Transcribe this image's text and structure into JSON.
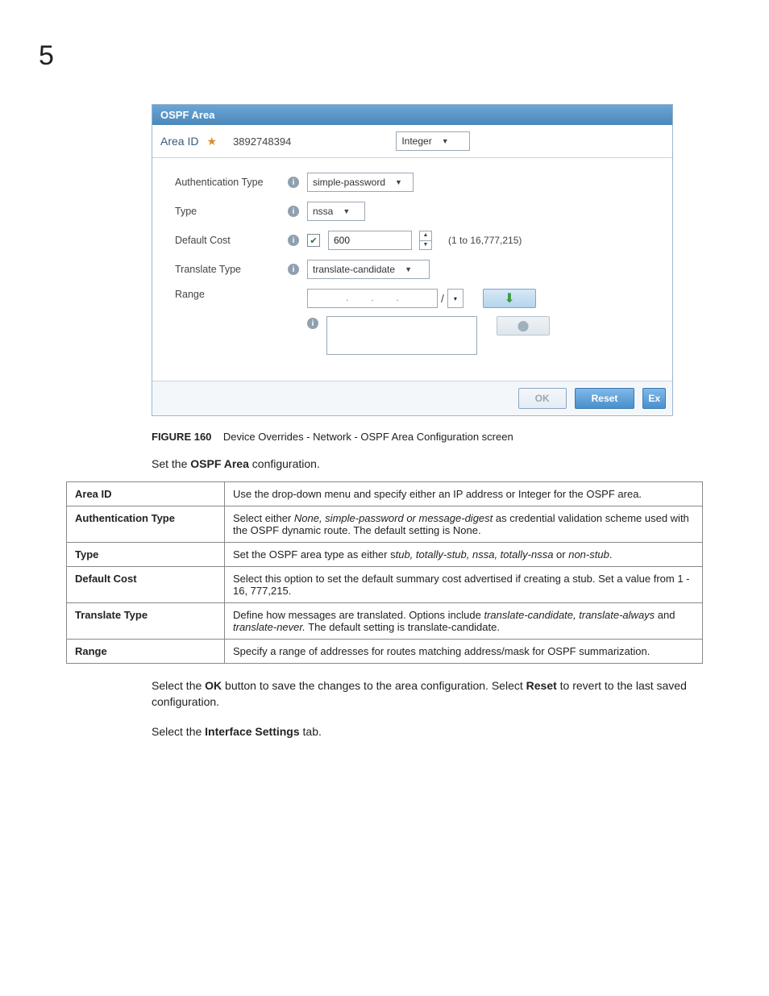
{
  "chapter": "5",
  "titlebar": "OSPF Area",
  "top": {
    "label": "Area ID",
    "value": "3892748394",
    "type_sel": "Integer"
  },
  "form": {
    "auth_label": "Authentication Type",
    "auth_value": "simple-password",
    "type_label": "Type",
    "type_value": "nssa",
    "defcost_label": "Default Cost",
    "defcost_value": "600",
    "defcost_hint": "(1 to 16,777,215)",
    "trans_label": "Translate Type",
    "trans_value": "translate-candidate",
    "range_label": "Range"
  },
  "buttons": {
    "ok": "OK",
    "reset": "Reset",
    "ex": "Ex"
  },
  "caption": {
    "fig": "FIGURE 160",
    "text": "Device Overrides - Network - OSPF Area Configuration screen"
  },
  "intro": {
    "pre": "Set the ",
    "bold": "OSPF Area",
    "post": " configuration."
  },
  "table": [
    {
      "k": "Area ID",
      "v": "Use the drop-down menu and specify either an IP address or Integer for the OSPF area."
    },
    {
      "k": "Authentication Type",
      "v": "Select either <i>None, simple-password or message-digest</i> as credential validation scheme used with the OSPF dynamic route. The default setting is None."
    },
    {
      "k": "Type",
      "v": "Set the OSPF area type as either s<i>tub, totally-stub, nssa, totally-nssa</i> or <i>non-stub</i>."
    },
    {
      "k": "Default Cost",
      "v": "Select this option to set the default summary cost advertised if creating a stub. Set a value from 1 - 16, 777,215."
    },
    {
      "k": "Translate Type",
      "v": "Define how messages are translated. Options include <i>translate-candidate, translate-always</i> and <i>translate-never.</i> The default setting is translate-candidate."
    },
    {
      "k": "Range",
      "v": "Specify a range of addresses for routes matching address/mask for OSPF summarization."
    }
  ],
  "para1": {
    "p1": "Select the ",
    "b1": "OK",
    "p2": " button to save the changes to the area configuration. Select ",
    "b2": "Reset",
    "p3": " to revert to the last saved configuration."
  },
  "para2": {
    "p1": "Select the ",
    "b1": "Interface Settings",
    "p2": " tab."
  }
}
